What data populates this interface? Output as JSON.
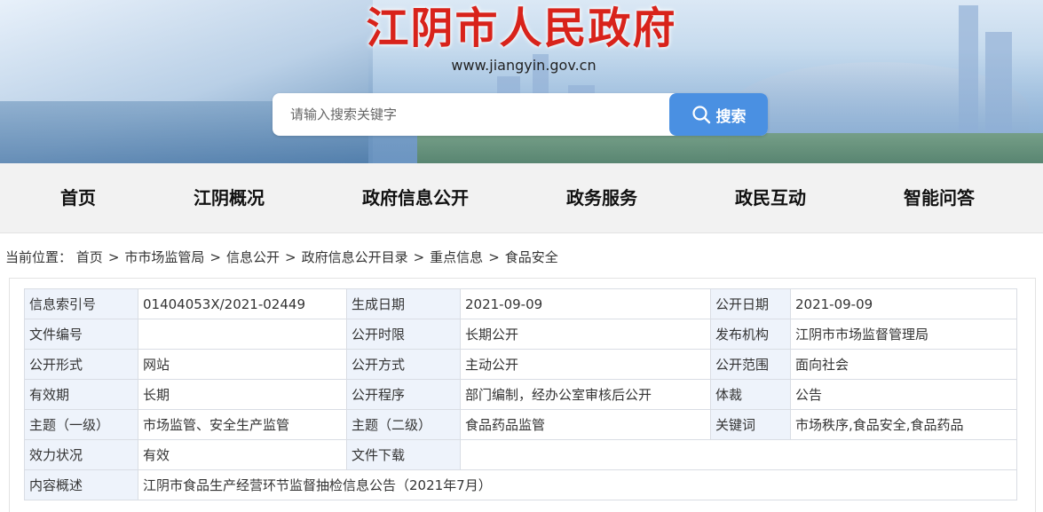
{
  "header": {
    "site_title": "江阴市人民政府",
    "site_url": "www.jiangyin.gov.cn",
    "search_placeholder": "请输入搜索关键字",
    "search_button": "搜索",
    "title_color": "#d8231b",
    "accent_color": "#4a90e2"
  },
  "nav": {
    "items": [
      {
        "label": "首页"
      },
      {
        "label": "江阴概况"
      },
      {
        "label": "政府信息公开"
      },
      {
        "label": "政务服务"
      },
      {
        "label": "政民互动"
      },
      {
        "label": "智能问答"
      }
    ]
  },
  "breadcrumb": {
    "prefix": "当前位置：",
    "items": [
      "首页",
      "市市场监管局",
      "信息公开",
      "政府信息公开目录",
      "重点信息",
      "食品安全"
    ],
    "separator": ">"
  },
  "info": {
    "index_no": {
      "label": "信息索引号",
      "value": "01404053X/2021-02449"
    },
    "gen_date": {
      "label": "生成日期",
      "value": "2021-09-09"
    },
    "pub_date": {
      "label": "公开日期",
      "value": "2021-09-09"
    },
    "doc_no": {
      "label": "文件编号",
      "value": ""
    },
    "pub_period": {
      "label": "公开时限",
      "value": "长期公开"
    },
    "issuer": {
      "label": "发布机构",
      "value": "江阴市市场监督管理局"
    },
    "pub_form": {
      "label": "公开形式",
      "value": "网站"
    },
    "pub_method": {
      "label": "公开方式",
      "value": "主动公开"
    },
    "pub_scope": {
      "label": "公开范围",
      "value": "面向社会"
    },
    "validity": {
      "label": "有效期",
      "value": "长期"
    },
    "pub_procedure": {
      "label": "公开程序",
      "value": "部门编制，经办公室审核后公开"
    },
    "genre": {
      "label": "体裁",
      "value": "公告"
    },
    "topic1": {
      "label": "主题（一级）",
      "value": "市场监管、安全生产监管"
    },
    "topic2": {
      "label": "主题（二级）",
      "value": "食品药品监管"
    },
    "keywords": {
      "label": "关键词",
      "value": "市场秩序,食品安全,食品药品"
    },
    "status": {
      "label": "效力状况",
      "value": "有效"
    },
    "download": {
      "label": "文件下载",
      "value": ""
    },
    "summary": {
      "label": "内容概述",
      "value": "江阴市食品生产经营环节监督抽检信息公告（2021年7月）"
    }
  }
}
